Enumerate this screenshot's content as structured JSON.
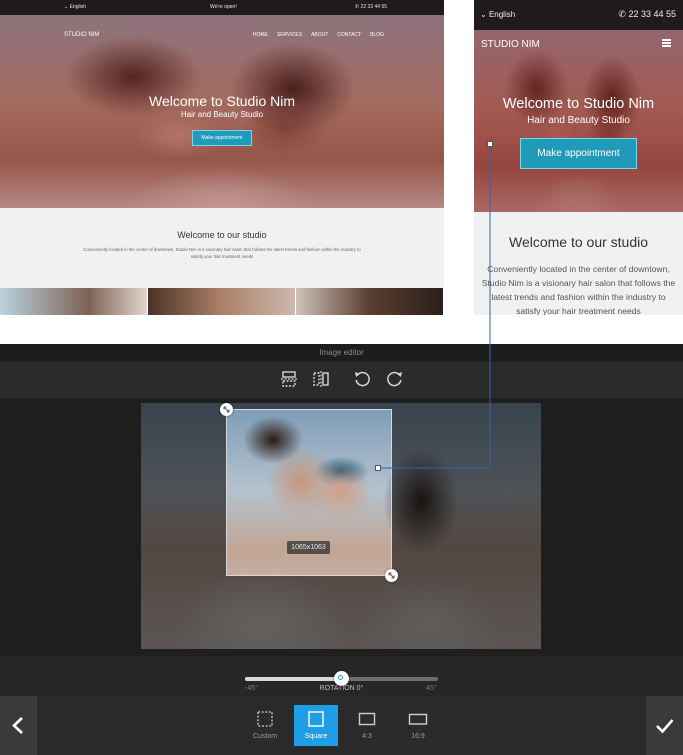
{
  "desktop": {
    "language": "English",
    "announcement": "We're open!",
    "phone": "22 33 44 55",
    "brand": "STUDIO NIM",
    "nav": [
      "HOME",
      "SERVICES",
      "ABOUT",
      "CONTACT",
      "BLOG"
    ],
    "hero_title": "Welcome to Studio Nim",
    "hero_subtitle": "Hair and Beauty Studio",
    "cta": "Make appointment",
    "intro_title": "Welcome to our studio",
    "intro_body": "Conveniently located in the center of downtown, Studio Nim is a visionary hair salon that follows the latest trends and fashion within the industry to satisfy your hair treatment needs"
  },
  "mobile": {
    "language": "English",
    "phone": "22 33 44 55",
    "brand": "STUDIO NIM",
    "hero_title": "Welcome to Studio Nim",
    "hero_subtitle": "Hair and Beauty Studio",
    "cta": "Make appointment",
    "intro_title": "Welcome to our studio",
    "intro_body": "Conveniently located in the center of downtown, Studio Nim is a visionary hair salon that follows the latest trends and fashion within the industry to satisfy your hair treatment needs"
  },
  "editor": {
    "title": "Image editor",
    "tools": [
      {
        "name": "flip-vertical-icon"
      },
      {
        "name": "flip-horizontal-icon"
      },
      {
        "name": "rotate-left-icon"
      },
      {
        "name": "rotate-right-icon"
      }
    ],
    "crop_dimensions": "1065x1063",
    "rotation": {
      "min_label": "-45°",
      "max_label": "45°",
      "label": "ROTATION 0°",
      "value": 0,
      "min": -45,
      "max": 45
    },
    "ratios": [
      {
        "label": "Custom",
        "active": false
      },
      {
        "label": "Square",
        "active": true
      },
      {
        "label": "4:3",
        "active": false
      },
      {
        "label": "16:9",
        "active": false
      }
    ],
    "accent_color": "#1e9ee6"
  }
}
